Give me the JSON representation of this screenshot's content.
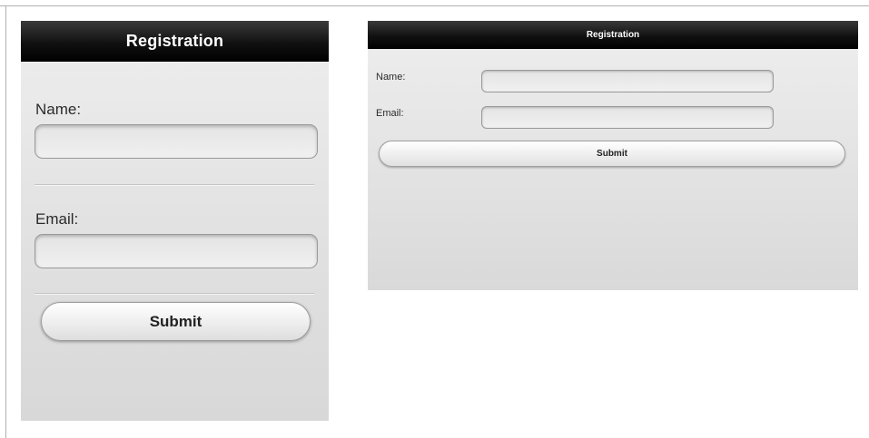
{
  "phone_view": {
    "header": {
      "title": "Registration"
    },
    "form": {
      "name_label": "Name:",
      "name_value": "",
      "email_label": "Email:",
      "email_value": "",
      "submit_label": "Submit"
    }
  },
  "tablet_view": {
    "header": {
      "title": "Registration"
    },
    "form": {
      "name_label": "Name:",
      "name_value": "",
      "email_label": "Email:",
      "email_value": "",
      "submit_label": "Submit"
    }
  },
  "colors": {
    "header_bg": "#000000",
    "header_text": "#ffffff",
    "page_bg": "#e4e4e4"
  }
}
